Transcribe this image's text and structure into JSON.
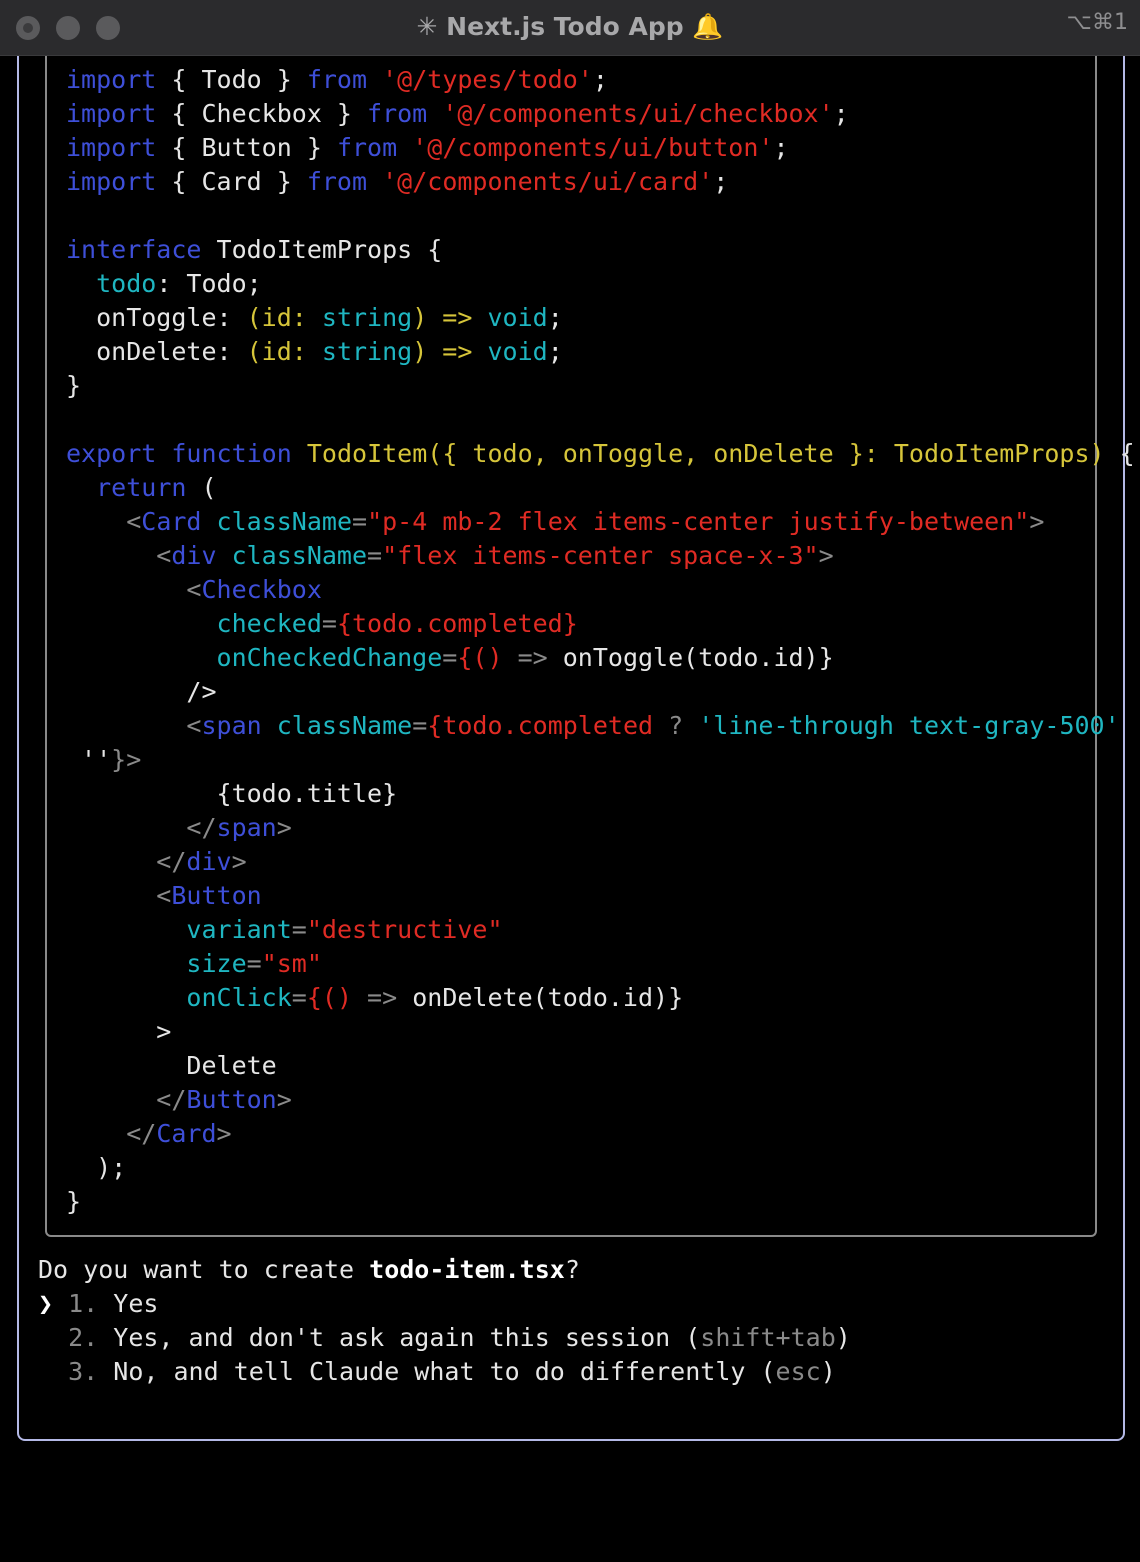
{
  "window": {
    "title": "✳ Next.js Todo App 🔔",
    "shortcut": "⌥⌘1"
  },
  "code_lines": [
    [
      {
        "t": "import",
        "c": "kw"
      },
      {
        "t": " { Todo } ",
        "c": "wht"
      },
      {
        "t": "from",
        "c": "kw"
      },
      {
        "t": " ",
        "c": "wht"
      },
      {
        "t": "'@/types/todo'",
        "c": "str"
      },
      {
        "t": ";",
        "c": "wht"
      }
    ],
    [
      {
        "t": "import",
        "c": "kw"
      },
      {
        "t": " { Checkbox } ",
        "c": "wht"
      },
      {
        "t": "from",
        "c": "kw"
      },
      {
        "t": " ",
        "c": "wht"
      },
      {
        "t": "'@/components/ui/checkbox'",
        "c": "str"
      },
      {
        "t": ";",
        "c": "wht"
      }
    ],
    [
      {
        "t": "import",
        "c": "kw"
      },
      {
        "t": " { Button } ",
        "c": "wht"
      },
      {
        "t": "from",
        "c": "kw"
      },
      {
        "t": " ",
        "c": "wht"
      },
      {
        "t": "'@/components/ui/button'",
        "c": "str"
      },
      {
        "t": ";",
        "c": "wht"
      }
    ],
    [
      {
        "t": "import",
        "c": "kw"
      },
      {
        "t": " { Card } ",
        "c": "wht"
      },
      {
        "t": "from",
        "c": "kw"
      },
      {
        "t": " ",
        "c": "wht"
      },
      {
        "t": "'@/components/ui/card'",
        "c": "str"
      },
      {
        "t": ";",
        "c": "wht"
      }
    ],
    [],
    [
      {
        "t": "interface",
        "c": "kw"
      },
      {
        "t": " TodoItemProps {",
        "c": "wht"
      }
    ],
    [
      {
        "t": "  ",
        "c": "wht"
      },
      {
        "t": "todo",
        "c": "cyan"
      },
      {
        "t": ": Todo;",
        "c": "wht"
      }
    ],
    [
      {
        "t": "  onToggle: ",
        "c": "wht"
      },
      {
        "t": "(id: ",
        "c": "ylw"
      },
      {
        "t": "string",
        "c": "cyan"
      },
      {
        "t": ") => ",
        "c": "ylw"
      },
      {
        "t": "void",
        "c": "cyan"
      },
      {
        "t": ";",
        "c": "wht"
      }
    ],
    [
      {
        "t": "  onDelete: ",
        "c": "wht"
      },
      {
        "t": "(id: ",
        "c": "ylw"
      },
      {
        "t": "string",
        "c": "cyan"
      },
      {
        "t": ") => ",
        "c": "ylw"
      },
      {
        "t": "void",
        "c": "cyan"
      },
      {
        "t": ";",
        "c": "wht"
      }
    ],
    [
      {
        "t": "}",
        "c": "wht"
      }
    ],
    [],
    [
      {
        "t": "export",
        "c": "kw"
      },
      {
        "t": " ",
        "c": "wht"
      },
      {
        "t": "function",
        "c": "kw"
      },
      {
        "t": " ",
        "c": "wht"
      },
      {
        "t": "TodoItem({ todo, onToggle, onDelete }: TodoItemProps)",
        "c": "ylw"
      },
      {
        "t": " {",
        "c": "wht"
      }
    ],
    [
      {
        "t": "  ",
        "c": "wht"
      },
      {
        "t": "return",
        "c": "kw"
      },
      {
        "t": " (",
        "c": "wht"
      }
    ],
    [
      {
        "t": "    <",
        "c": "gry"
      },
      {
        "t": "Card",
        "c": "kw"
      },
      {
        "t": " ",
        "c": "wht"
      },
      {
        "t": "className",
        "c": "cyan"
      },
      {
        "t": "=",
        "c": "gry"
      },
      {
        "t": "\"p-4 mb-2 flex items-center justify-between\"",
        "c": "str"
      },
      {
        "t": ">",
        "c": "gry"
      }
    ],
    [
      {
        "t": "      <",
        "c": "gry"
      },
      {
        "t": "div",
        "c": "kw"
      },
      {
        "t": " ",
        "c": "wht"
      },
      {
        "t": "className",
        "c": "cyan"
      },
      {
        "t": "=",
        "c": "gry"
      },
      {
        "t": "\"flex items-center space-x-3\"",
        "c": "str"
      },
      {
        "t": ">",
        "c": "gry"
      }
    ],
    [
      {
        "t": "        <",
        "c": "gry"
      },
      {
        "t": "Checkbox",
        "c": "kw"
      }
    ],
    [
      {
        "t": "          ",
        "c": "wht"
      },
      {
        "t": "checked",
        "c": "cyan"
      },
      {
        "t": "=",
        "c": "gry"
      },
      {
        "t": "{todo.completed}",
        "c": "str"
      }
    ],
    [
      {
        "t": "          ",
        "c": "wht"
      },
      {
        "t": "onCheckedChange",
        "c": "cyan"
      },
      {
        "t": "=",
        "c": "gry"
      },
      {
        "t": "{()",
        "c": "str"
      },
      {
        "t": " => ",
        "c": "gry"
      },
      {
        "t": "onToggle(todo.id)}",
        "c": "wht"
      }
    ],
    [
      {
        "t": "        />",
        "c": "wht"
      }
    ],
    [
      {
        "t": "        <",
        "c": "gry"
      },
      {
        "t": "span",
        "c": "kw"
      },
      {
        "t": " ",
        "c": "wht"
      },
      {
        "t": "className",
        "c": "cyan"
      },
      {
        "t": "=",
        "c": "gry"
      },
      {
        "t": "{todo.completed",
        "c": "str"
      },
      {
        "t": " ? ",
        "c": "gry"
      },
      {
        "t": "'line-through text-gray-500'",
        "c": "cyan"
      },
      {
        "t": " :",
        "c": "cyan"
      }
    ],
    [
      {
        "t": " ''",
        "c": "wht"
      },
      {
        "t": "}>",
        "c": "gry"
      }
    ],
    [
      {
        "t": "          {todo.title}",
        "c": "wht"
      }
    ],
    [
      {
        "t": "        </",
        "c": "gry"
      },
      {
        "t": "span",
        "c": "kw"
      },
      {
        "t": ">",
        "c": "gry"
      }
    ],
    [
      {
        "t": "      </",
        "c": "gry"
      },
      {
        "t": "div",
        "c": "kw"
      },
      {
        "t": ">",
        "c": "gry"
      }
    ],
    [
      {
        "t": "      <",
        "c": "gry"
      },
      {
        "t": "Button",
        "c": "kw"
      }
    ],
    [
      {
        "t": "        ",
        "c": "wht"
      },
      {
        "t": "variant",
        "c": "cyan"
      },
      {
        "t": "=",
        "c": "gry"
      },
      {
        "t": "\"destructive\"",
        "c": "str"
      }
    ],
    [
      {
        "t": "        ",
        "c": "wht"
      },
      {
        "t": "size",
        "c": "cyan"
      },
      {
        "t": "=",
        "c": "gry"
      },
      {
        "t": "\"sm\"",
        "c": "str"
      }
    ],
    [
      {
        "t": "        ",
        "c": "wht"
      },
      {
        "t": "onClick",
        "c": "cyan"
      },
      {
        "t": "=",
        "c": "gry"
      },
      {
        "t": "{()",
        "c": "str"
      },
      {
        "t": " => ",
        "c": "gry"
      },
      {
        "t": "onDelete(todo.id)}",
        "c": "wht"
      }
    ],
    [
      {
        "t": "      >",
        "c": "wht"
      }
    ],
    [
      {
        "t": "        Delete",
        "c": "wht"
      }
    ],
    [
      {
        "t": "      </",
        "c": "gry"
      },
      {
        "t": "Button",
        "c": "kw"
      },
      {
        "t": ">",
        "c": "gry"
      }
    ],
    [
      {
        "t": "    </",
        "c": "gry"
      },
      {
        "t": "Card",
        "c": "kw"
      },
      {
        "t": ">",
        "c": "gry"
      }
    ],
    [
      {
        "t": "  );",
        "c": "wht"
      }
    ],
    [
      {
        "t": "}",
        "c": "wht"
      }
    ]
  ],
  "prompt": {
    "question_prefix": "Do you want to create ",
    "filename": "todo-item.tsx",
    "question_suffix": "?",
    "cursor": "❯",
    "options": [
      {
        "num": "1.",
        "label": "Yes",
        "hint": ""
      },
      {
        "num": "2.",
        "label": "Yes, and don't ask again this session (",
        "hint": "shift+tab",
        "close": ")"
      },
      {
        "num": "3.",
        "label": "No, and tell Claude what to do differently (",
        "hint": "esc",
        "close": ")"
      }
    ]
  }
}
